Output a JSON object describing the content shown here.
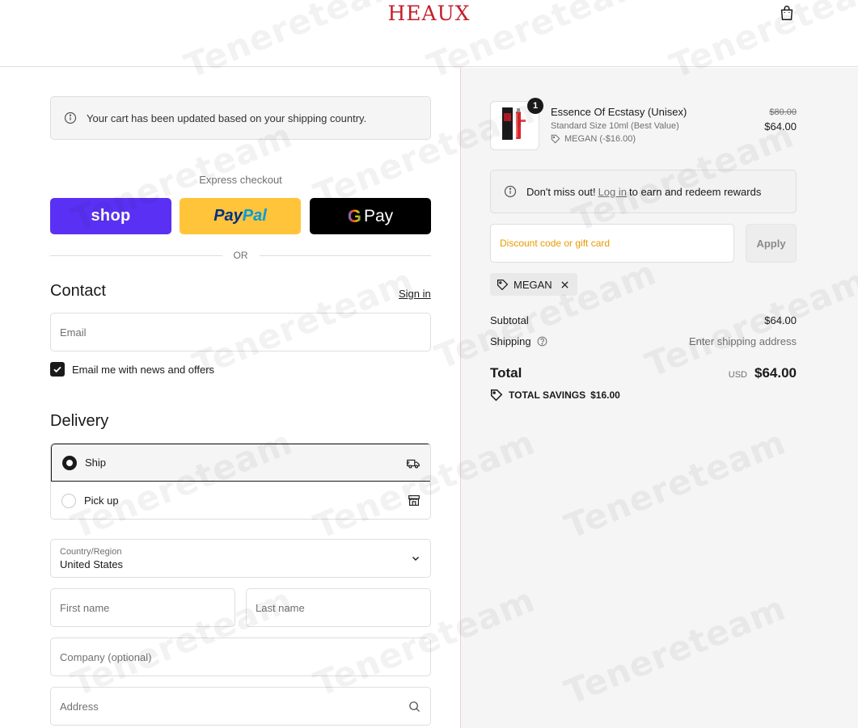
{
  "header": {
    "brand": "HEAUX",
    "cart_icon": "shopping-bag-icon"
  },
  "notice": {
    "text": "Your cart has been updated based on your shipping country.",
    "icon": "info-icon"
  },
  "express": {
    "label": "Express checkout",
    "shop_label": "shop",
    "paypal_part1": "Pay",
    "paypal_part2": "Pal",
    "gpay_g": "G",
    "gpay_label": "Pay",
    "or_label": "OR"
  },
  "contact": {
    "title": "Contact",
    "signin_label": "Sign in",
    "email_placeholder": "Email",
    "newsletter_label": "Email me with news and offers",
    "newsletter_checked": true
  },
  "delivery": {
    "title": "Delivery",
    "options": [
      {
        "label": "Ship",
        "selected": true,
        "icon": "truck-icon"
      },
      {
        "label": "Pick up",
        "selected": false,
        "icon": "store-icon"
      }
    ],
    "country_label": "Country/Region",
    "country_value": "United States",
    "first_name_placeholder": "First name",
    "last_name_placeholder": "Last name",
    "company_placeholder": "Company (optional)",
    "address_placeholder": "Address"
  },
  "summary": {
    "product": {
      "name": "Essence Of Ecstasy (Unisex)",
      "variant": "Standard Size 10ml (Best Value)",
      "discount": "MEGAN (-$16.00)",
      "old_price": "$80.00",
      "price": "$64.00",
      "quantity": "1"
    },
    "rewards": {
      "before": "Don't miss out!",
      "link": "Log in",
      "after": "to earn and redeem rewards"
    },
    "discount_placeholder": "Discount code or gift card",
    "apply_label": "Apply",
    "applied_code": "MEGAN",
    "subtotal_label": "Subtotal",
    "subtotal_value": "$64.00",
    "shipping_label": "Shipping",
    "shipping_value": "Enter shipping address",
    "total_label": "Total",
    "currency": "USD",
    "total_value": "$64.00",
    "savings_label": "TOTAL SAVINGS",
    "savings_value": "$16.00"
  },
  "watermark": "Tenereteam",
  "colors": {
    "brand": "#c41e2a",
    "shop_pay": "#5a31f4",
    "paypal": "#ffc439",
    "discount_text": "#e89a00"
  }
}
